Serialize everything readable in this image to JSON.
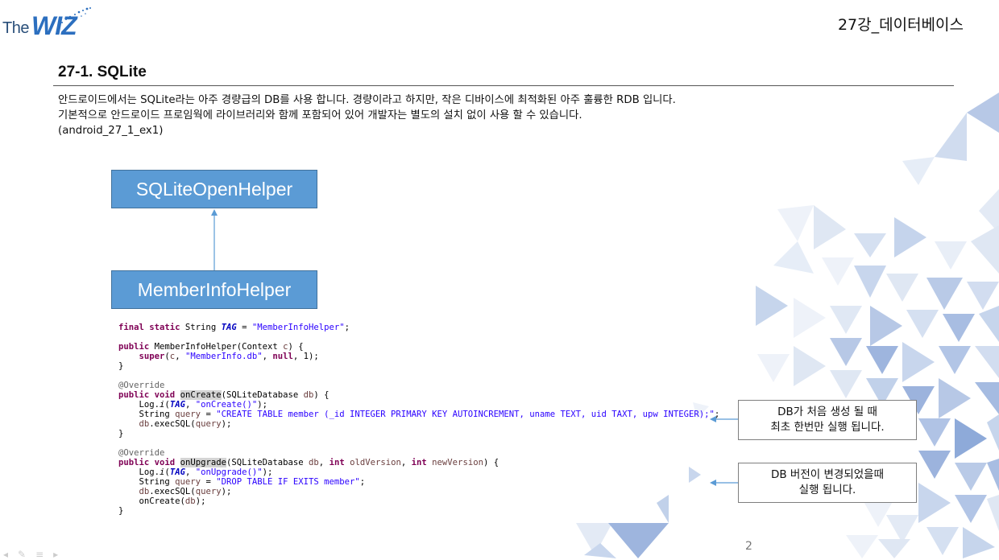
{
  "logo": {
    "the": "The",
    "wiz": "WIZ"
  },
  "header": {
    "title": "27강_데이터베이스"
  },
  "section": {
    "title": "27-1. SQLite"
  },
  "description": {
    "line1": "안드로이드에서는 SQLite라는 아주 경량급의 DB를 사용 합니다. 경량이라고 하지만, 작은 디바이스에 최적화된 아주 훌륭한 RDB 입니다.",
    "line2": "기본적으로 안드로이드 프로임웍에 라이브러리와 함께 포함되어 있어 개발자는 별도의 설치 없이 사용 할 수 있습니다.",
    "line3": "(android_27_1_ex1)"
  },
  "diagram": {
    "parent": "SQLiteOpenHelper",
    "child": "MemberInfoHelper"
  },
  "code": {
    "l1_kw": "final static",
    "l1_type": " String ",
    "l1_field": "TAG",
    "l1_eq": " = ",
    "l1_str": "\"MemberInfoHelper\"",
    "l1_end": ";",
    "l3_kw": "public",
    "l3_rest": " MemberInfoHelper(Context ",
    "l3_var": "c",
    "l3_end": ") {",
    "l4_kw": "super",
    "l4_open": "(",
    "l4_var": "c",
    "l4_sep": ", ",
    "l4_str": "\"MemberInfo.db\"",
    "l4_sep2": ", ",
    "l4_null": "null",
    "l4_end": ", 1);",
    "l5": "}",
    "l7_ann": "@Override",
    "l8_kw": "public void",
    "l8_sp": " ",
    "l8_method": "onCreate",
    "l8_rest": "(SQLiteDatabase ",
    "l8_var": "db",
    "l8_end": ") {",
    "l9_pre": "Log.",
    "l9_i": "i",
    "l9_open": "(",
    "l9_field": "TAG",
    "l9_sep": ", ",
    "l9_str": "\"onCreate()\"",
    "l9_end": ");",
    "l10_type": "String ",
    "l10_var": "query",
    "l10_eq": " = ",
    "l10_str": "\"CREATE TABLE member (_id INTEGER PRIMARY KEY AUTOINCREMENT, uname TEXT, uid TAXT, upw INTEGER);\"",
    "l10_end": ";",
    "l11_var": "db",
    "l11_mid": ".execSQL(",
    "l11_var2": "query",
    "l11_end": ");",
    "l12": "}",
    "l14_ann": "@Override",
    "l15_kw": "public void",
    "l15_sp": " ",
    "l15_method": "onUpgrade",
    "l15_rest": "(SQLiteDatabase ",
    "l15_var": "db",
    "l15_sep": ", ",
    "l15_kw2": "int",
    "l15_sp2": " ",
    "l15_var2": "oldVersion",
    "l15_sep2": ", ",
    "l15_kw3": "int",
    "l15_sp3": " ",
    "l15_var3": "newVersion",
    "l15_end": ") {",
    "l16_pre": "Log.",
    "l16_i": "i",
    "l16_open": "(",
    "l16_field": "TAG",
    "l16_sep": ", ",
    "l16_str": "\"onUpgrade()\"",
    "l16_end": ");",
    "l17_type": "String ",
    "l17_var": "query",
    "l17_eq": " = ",
    "l17_str": "\"DROP TABLE IF EXITS member\"",
    "l17_end": ";",
    "l18_var": "db",
    "l18_mid": ".execSQL(",
    "l18_var2": "query",
    "l18_end": ");",
    "l19_pre": "onCreate(",
    "l19_var": "db",
    "l19_end": ");",
    "l20": "}"
  },
  "callouts": {
    "create_line1": "DB가 처음 생성 될 때",
    "create_line2": "최초 한번만 실행 됩니다.",
    "upgrade_line1": "DB 버전이 변경되었을때",
    "upgrade_line2": "실행 됩니다."
  },
  "page": {
    "number": "2"
  },
  "colors": {
    "box_fill": "#5b9bd5",
    "box_border": "#41719c",
    "arrow": "#5b9bd5",
    "deco_dark": "#8eaad9",
    "deco_light": "#dfe7f3"
  }
}
